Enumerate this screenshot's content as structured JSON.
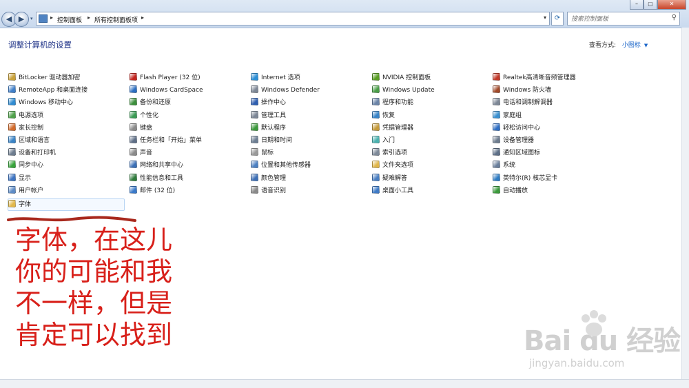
{
  "address": {
    "crumbs": [
      "控制面板",
      "所有控制面板项"
    ]
  },
  "search": {
    "placeholder": "搜索控制面板"
  },
  "header": {
    "title": "调整计算机的设置",
    "view_label": "查看方式:",
    "view_value": "小图标"
  },
  "columns": [
    [
      {
        "label": "BitLocker 驱动器加密",
        "color": "#c9a13a"
      },
      {
        "label": "RemoteApp 和桌面连接",
        "color": "#3f7fc9"
      },
      {
        "label": "Windows 移动中心",
        "color": "#2f8bd1"
      },
      {
        "label": "电源选项",
        "color": "#4fa14a"
      },
      {
        "label": "家长控制",
        "color": "#d26a2a"
      },
      {
        "label": "区域和语言",
        "color": "#3a84c7"
      },
      {
        "label": "设备和打印机",
        "color": "#6d7c8f"
      },
      {
        "label": "同步中心",
        "color": "#37a33a"
      },
      {
        "label": "显示",
        "color": "#3d74c2"
      },
      {
        "label": "用户帐户",
        "color": "#5d8bc6"
      },
      {
        "label": "字体",
        "color": "#e2b84a"
      }
    ],
    [
      {
        "label": "Flash Player (32 位)",
        "color": "#c4251f"
      },
      {
        "label": "Windows CardSpace",
        "color": "#2c6fc2"
      },
      {
        "label": "备份和还原",
        "color": "#3b8e3b"
      },
      {
        "label": "个性化",
        "color": "#3a9a54"
      },
      {
        "label": "键盘",
        "color": "#8a8a8a"
      },
      {
        "label": "任务栏和「开始」菜单",
        "color": "#5f6f87"
      },
      {
        "label": "声音",
        "color": "#8a8a8a"
      },
      {
        "label": "网络和共享中心",
        "color": "#3b6fb6"
      },
      {
        "label": "性能信息和工具",
        "color": "#2e7b3b"
      },
      {
        "label": "邮件 (32 位)",
        "color": "#3a79c9"
      }
    ],
    [
      {
        "label": "Internet 选项",
        "color": "#2c8fd6"
      },
      {
        "label": "Windows Defender",
        "color": "#7d8796"
      },
      {
        "label": "操作中心",
        "color": "#2f5fb0"
      },
      {
        "label": "管理工具",
        "color": "#7d8796"
      },
      {
        "label": "默认程序",
        "color": "#3c9a3c"
      },
      {
        "label": "日期和时间",
        "color": "#6d7e93"
      },
      {
        "label": "鼠标",
        "color": "#9a9a9a"
      },
      {
        "label": "位置和其他传感器",
        "color": "#4c80c2"
      },
      {
        "label": "颜色管理",
        "color": "#3d6fb6"
      },
      {
        "label": "语音识别",
        "color": "#8a8a8a"
      }
    ],
    [
      {
        "label": "NVIDIA 控制面板",
        "color": "#5a9e25"
      },
      {
        "label": "Windows Update",
        "color": "#4a9e48"
      },
      {
        "label": "程序和功能",
        "color": "#6b84a8"
      },
      {
        "label": "恢复",
        "color": "#3a84c7"
      },
      {
        "label": "凭据管理器",
        "color": "#c59b3b"
      },
      {
        "label": "入门",
        "color": "#4bb2b0"
      },
      {
        "label": "索引选项",
        "color": "#7e8a99"
      },
      {
        "label": "文件夹选项",
        "color": "#e0b64a"
      },
      {
        "label": "疑难解答",
        "color": "#4a7fc2"
      },
      {
        "label": "桌面小工具",
        "color": "#3f7bc6"
      }
    ],
    [
      {
        "label": "Realtek高清晰音频管理器",
        "color": "#c23a2a"
      },
      {
        "label": "Windows 防火墙",
        "color": "#a24a2a"
      },
      {
        "label": "电话和调制解调器",
        "color": "#7d8796"
      },
      {
        "label": "家庭组",
        "color": "#3a8fcf"
      },
      {
        "label": "轻松访问中心",
        "color": "#2f6fc4"
      },
      {
        "label": "设备管理器",
        "color": "#6d7c8f"
      },
      {
        "label": "通知区域图标",
        "color": "#5d6f87"
      },
      {
        "label": "系统",
        "color": "#6a7f9c"
      },
      {
        "label": "英特尔(R) 核芯显卡",
        "color": "#2e7cc4"
      },
      {
        "label": "自动播放",
        "color": "#3c9a3c"
      }
    ]
  ],
  "annotation": {
    "lines": [
      "字体，在这儿",
      "你的可能和我",
      "不一样，但是",
      "肯定可以找到"
    ],
    "color": "#d8201a"
  },
  "watermark": {
    "brand": "Bai du 经验",
    "url": "jingyan.baidu.com"
  }
}
